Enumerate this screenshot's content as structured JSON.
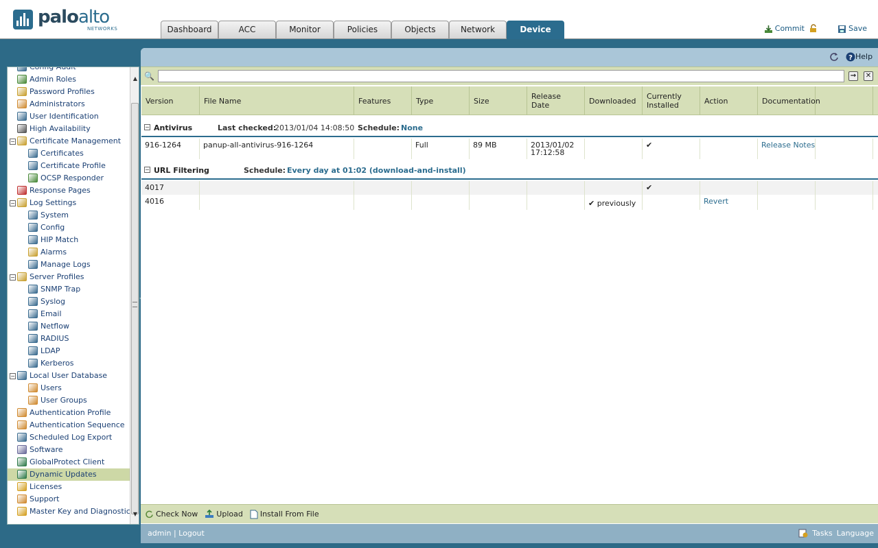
{
  "brand": {
    "name_a": "palo",
    "name_b": "alto",
    "sub": "NETWORKS"
  },
  "tabs": [
    {
      "label": "Dashboard"
    },
    {
      "label": "ACC"
    },
    {
      "label": "Monitor"
    },
    {
      "label": "Policies"
    },
    {
      "label": "Objects"
    },
    {
      "label": "Network"
    },
    {
      "label": "Device",
      "active": true
    }
  ],
  "header_actions": {
    "commit": "Commit",
    "save": "Save"
  },
  "toolbar": {
    "help": "Help"
  },
  "nav": [
    {
      "label": "Config Audit",
      "level": 1,
      "icon": "audit-icon"
    },
    {
      "label": "Admin Roles",
      "level": 1,
      "icon": "admin-roles-icon"
    },
    {
      "label": "Password Profiles",
      "level": 1,
      "icon": "password-icon"
    },
    {
      "label": "Administrators",
      "level": 1,
      "icon": "user-icon"
    },
    {
      "label": "User Identification",
      "level": 1,
      "icon": "id-card-icon"
    },
    {
      "label": "High Availability",
      "level": 1,
      "icon": "server-icon"
    },
    {
      "label": "Certificate Management",
      "level": 1,
      "icon": "folder-icon",
      "toggle": true
    },
    {
      "label": "Certificates",
      "level": 2,
      "icon": "certificate-icon"
    },
    {
      "label": "Certificate Profile",
      "level": 2,
      "icon": "certificate-icon"
    },
    {
      "label": "OCSP Responder",
      "level": 2,
      "icon": "ocsp-icon"
    },
    {
      "label": "Response Pages",
      "level": 1,
      "icon": "no-entry-icon"
    },
    {
      "label": "Log Settings",
      "level": 1,
      "icon": "folder-icon",
      "toggle": true
    },
    {
      "label": "System",
      "level": 2,
      "icon": "log-icon"
    },
    {
      "label": "Config",
      "level": 2,
      "icon": "log-icon"
    },
    {
      "label": "HIP Match",
      "level": 2,
      "icon": "log-icon"
    },
    {
      "label": "Alarms",
      "level": 2,
      "icon": "alarm-icon"
    },
    {
      "label": "Manage Logs",
      "level": 2,
      "icon": "log-icon"
    },
    {
      "label": "Server Profiles",
      "level": 1,
      "icon": "folder-icon",
      "toggle": true
    },
    {
      "label": "SNMP Trap",
      "level": 2,
      "icon": "server-profile-icon"
    },
    {
      "label": "Syslog",
      "level": 2,
      "icon": "server-profile-icon"
    },
    {
      "label": "Email",
      "level": 2,
      "icon": "server-profile-icon"
    },
    {
      "label": "Netflow",
      "level": 2,
      "icon": "server-profile-icon"
    },
    {
      "label": "RADIUS",
      "level": 2,
      "icon": "server-profile-icon"
    },
    {
      "label": "LDAP",
      "level": 2,
      "icon": "server-profile-icon"
    },
    {
      "label": "Kerberos",
      "level": 2,
      "icon": "server-profile-icon"
    },
    {
      "label": "Local User Database",
      "level": 1,
      "icon": "database-icon",
      "toggle": true
    },
    {
      "label": "Users",
      "level": 2,
      "icon": "user-icon"
    },
    {
      "label": "User Groups",
      "level": 2,
      "icon": "user-group-icon"
    },
    {
      "label": "Authentication Profile",
      "level": 1,
      "icon": "user-group-icon"
    },
    {
      "label": "Authentication Sequence",
      "level": 1,
      "icon": "auth-sequence-icon"
    },
    {
      "label": "Scheduled Log Export",
      "level": 1,
      "icon": "export-icon"
    },
    {
      "label": "Software",
      "level": 1,
      "icon": "software-icon"
    },
    {
      "label": "GlobalProtect Client",
      "level": 1,
      "icon": "globe-icon"
    },
    {
      "label": "Dynamic Updates",
      "level": 1,
      "icon": "globe-icon",
      "selected": true
    },
    {
      "label": "Licenses",
      "level": 1,
      "icon": "key-icon"
    },
    {
      "label": "Support",
      "level": 1,
      "icon": "support-icon"
    },
    {
      "label": "Master Key and Diagnostics",
      "level": 1,
      "icon": "lock-icon"
    }
  ],
  "columns": [
    "Version",
    "File Name",
    "Features",
    "Type",
    "Size",
    "Release Date",
    "Downloaded",
    "Currently Installed",
    "Action",
    "Documentation",
    ""
  ],
  "groups": {
    "antivirus": {
      "name": "Antivirus",
      "last_checked_label": "Last checked:",
      "last_checked": "2013/01/04 14:08:50",
      "schedule_label": "Schedule:",
      "schedule": "None",
      "rows": [
        {
          "version": "916-1264",
          "file": "panup-all-antivirus-916-1264",
          "features": "",
          "type": "Full",
          "size": "89 MB",
          "release_date_1": "2013/01/02",
          "release_date_2": "17:12:58",
          "downloaded": "",
          "installed": "✔",
          "action": "",
          "doc": "Release Notes"
        }
      ]
    },
    "url": {
      "name": "URL Filtering",
      "schedule_label": "Schedule:",
      "schedule": "Every day at 01:02 (download-and-install)",
      "rows": [
        {
          "version": "4017",
          "installed": "✔",
          "downloaded": "",
          "action": ""
        },
        {
          "version": "4016",
          "installed": "",
          "downloaded": "previously",
          "action": "Revert"
        }
      ]
    }
  },
  "bottom_actions": {
    "check": "Check Now",
    "upload": "Upload",
    "install": "Install From File"
  },
  "status": {
    "user": "admin",
    "logout": "Logout",
    "tasks": "Tasks",
    "language": "Language"
  }
}
